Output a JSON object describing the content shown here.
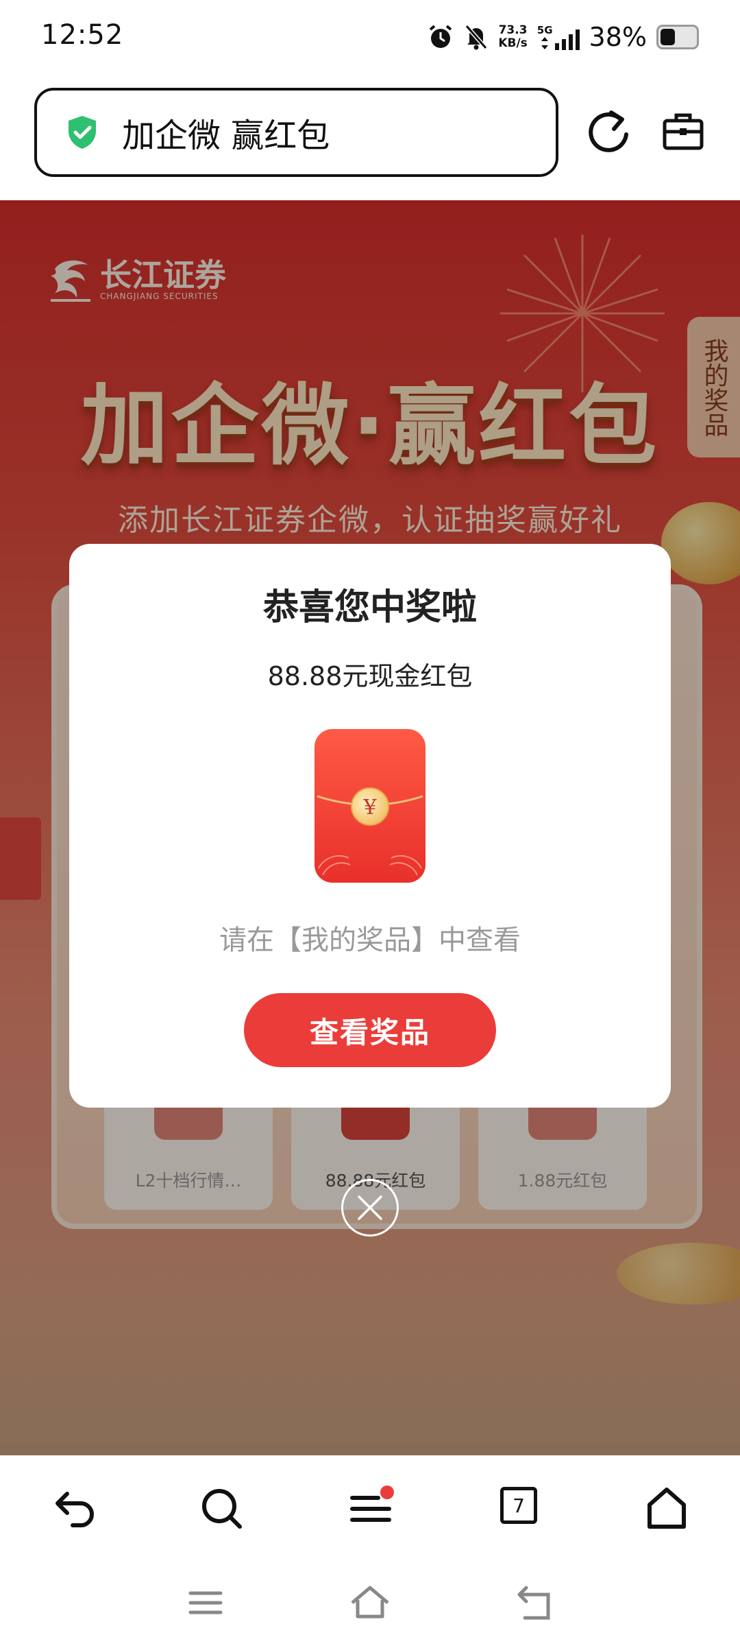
{
  "status_bar": {
    "time": "12:52",
    "speed_value": "73.3",
    "speed_unit": "KB/s",
    "network": "5G",
    "battery": "38%",
    "battery_level": 0.38
  },
  "browser": {
    "url_title": "加企微 赢红包",
    "tabs_count": "7"
  },
  "page": {
    "logo_cn": "长江证券",
    "logo_en": "CHANGJIANG SECURITIES",
    "headline": "加企微·赢红包",
    "subline": "添加长江证券企微，认证抽奖赢好礼",
    "side_tab": "我的奖品",
    "prize_cards": [
      {
        "label": "L2十档行情…"
      },
      {
        "label": "88.88元红包"
      },
      {
        "label": "1.88元红包"
      }
    ]
  },
  "modal": {
    "title": "恭喜您中奖啦",
    "prize": "88.88元现金红包",
    "envelope_symbol": "¥",
    "hint": "请在【我的奖品】中查看",
    "button": "查看奖品"
  },
  "colors": {
    "accent_red": "#ea3d3a",
    "safe_green": "#2fbf71"
  }
}
